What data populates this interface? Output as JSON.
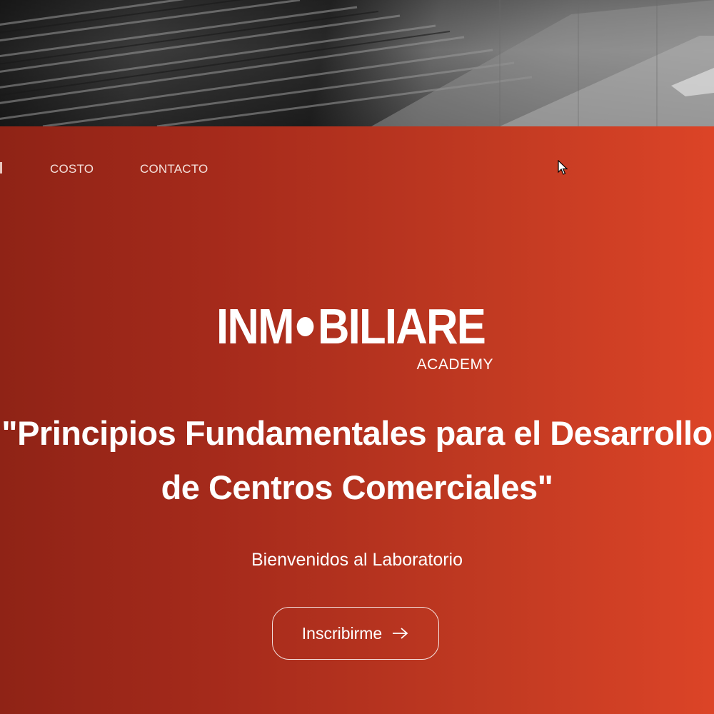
{
  "nav": {
    "items": [
      {
        "label": "COSTO"
      },
      {
        "label": "CONTACTO"
      }
    ]
  },
  "logo": {
    "word_left": "INM",
    "word_right": "BILIARE",
    "subtitle": "ACADEMY"
  },
  "hero": {
    "headline_line1": "\"Principios Fundamentales para el Desarrollo",
    "headline_line2": "de Centros Comerciales\"",
    "welcome": "Bienvenidos al Laboratorio",
    "cta_label": "Inscribirme",
    "cta_icon": "arrow-right-icon"
  },
  "colors": {
    "hero_gradient_start": "#8f2316",
    "hero_gradient_end": "#dc4427",
    "text": "#ffffff"
  }
}
